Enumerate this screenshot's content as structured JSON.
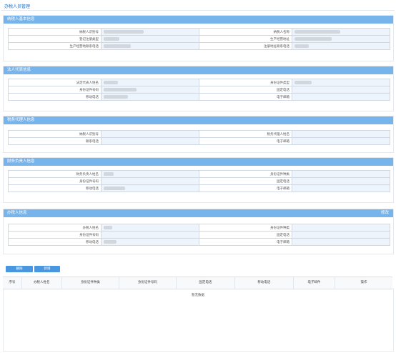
{
  "page": {
    "title": "办税人员管理"
  },
  "sections": {
    "taxpayer": {
      "header": "纳税人基本信息",
      "rows": [
        [
          "纳税人识别号",
          "纳税人名称"
        ],
        [
          "登记注册类型",
          "生产经营地址"
        ],
        [
          "生产经营地联系电话",
          "注册地址联系电话"
        ]
      ]
    },
    "legal_rep": {
      "header": "法人代表信息",
      "rows": [
        [
          "法定代表人姓名",
          "身份证件类型"
        ],
        [
          "身份证件号码",
          "固定电话"
        ],
        [
          "移动电话",
          "电子邮箱"
        ]
      ]
    },
    "tax_agent": {
      "header": "税务代理人信息",
      "rows": [
        [
          "纳税人识别号",
          "税务代理人姓名"
        ],
        [
          "联系电话",
          "电子邮箱"
        ]
      ]
    },
    "finance": {
      "header": "财务负责人信息",
      "rows": [
        [
          "财务负责人姓名",
          "身份证件种类"
        ],
        [
          "身份证件号码",
          "固定电话"
        ],
        [
          "移动电话",
          "电子邮箱"
        ]
      ]
    },
    "tax_handler": {
      "header": "办税人信息",
      "edit_label": "修改",
      "rows": [
        [
          "办税人姓名",
          "身份证件种类"
        ],
        [
          "身份证件号码",
          "固定电话"
        ],
        [
          "移动电话",
          "电子邮箱"
        ]
      ]
    }
  },
  "buttons": {
    "delete": "删除",
    "add": "新增"
  },
  "table": {
    "columns": [
      "序号",
      "办税人姓名",
      "身份证件种类",
      "身份证件号码",
      "固定电话",
      "移动电话",
      "电子邮件",
      "操作"
    ],
    "empty_text": "暂无数据"
  }
}
